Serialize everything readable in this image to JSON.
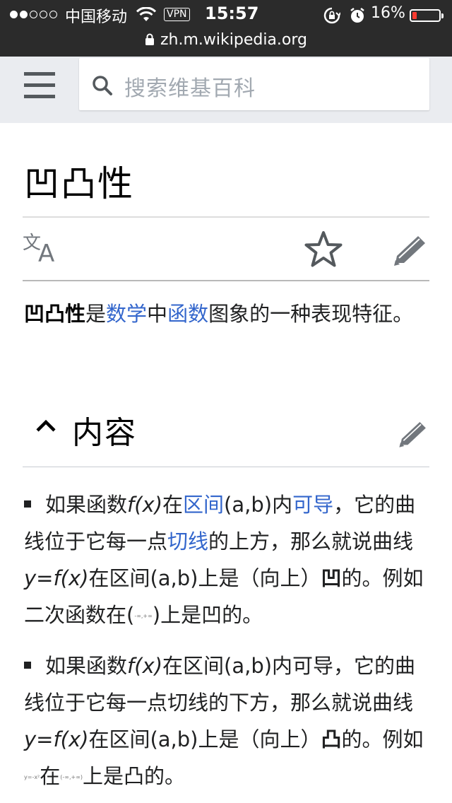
{
  "status_bar": {
    "carrier": "中国移动",
    "vpn": "VPN",
    "time": "15:57",
    "battery_percent": "16%",
    "battery_level": 0.16,
    "url": "zh.m.wikipedia.org"
  },
  "header": {
    "search_placeholder": "搜索维基百科"
  },
  "article": {
    "title": "凹凸性",
    "lead": {
      "bold": "凹凸性",
      "t1": "是",
      "link1": "数学",
      "t2": "中",
      "link2": "函数",
      "t3": "图象的一种表现特征。"
    },
    "section": {
      "heading": "内容"
    },
    "bullet1": {
      "t1": "如果函数",
      "fx": "f(x)",
      "t2": "在",
      "link1": "区间",
      "t3": "(a,b)内",
      "link2": "可导",
      "t4": "，它的曲线位于它每一点",
      "link3": "切线",
      "t5": "的上方，那么就说曲线",
      "yfx": "y=f(x)",
      "t6": "在区间(a,b)上是（向上）",
      "bold": "凹",
      "t7": "的。例如二次函数在(",
      "tiny": "-∞,+∞",
      "t8": ")上是凹的。"
    },
    "bullet2": {
      "t1": "如果函数",
      "fx": "f(x)",
      "t2": "在区间(a,b)内可导，它的曲线位于它每一点切线的下方，那么就说曲线",
      "yfx": "y=f(x)",
      "t3": "在区间(a,b)上是（向上）",
      "bold": "凸",
      "t4": "的。例如",
      "tiny1": "y=-x²",
      "t5": "在",
      "tiny2": "(-∞,+∞)",
      "t6": "上是凸的。"
    }
  },
  "colors": {
    "link": "#3366cc",
    "header_bg": "#eaecf0",
    "status_bg": "#2b2b2b",
    "battery": "#ff3b30"
  },
  "icons": [
    "signal-dots-icon",
    "wifi-icon",
    "lock-icon",
    "rotation-lock-icon",
    "alarm-icon",
    "battery-icon",
    "menu-icon",
    "search-icon",
    "language-icon",
    "star-icon",
    "edit-pencil-icon",
    "chevron-up-icon"
  ]
}
